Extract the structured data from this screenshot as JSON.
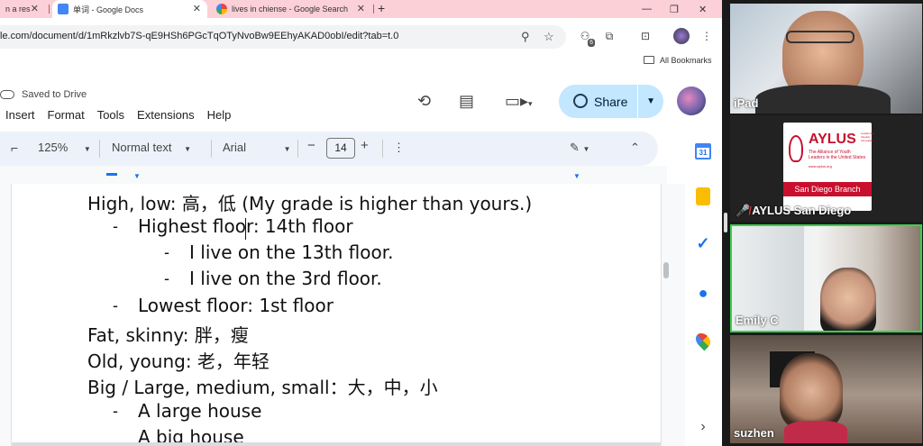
{
  "tabs": [
    {
      "title": "n a res",
      "close": "✕"
    },
    {
      "title": "单词 - Google Docs",
      "close": "✕"
    },
    {
      "title": "lives in chiense - Google Search",
      "close": "✕"
    }
  ],
  "new_tab": "+",
  "window_controls": {
    "minimize": "—",
    "restore": "❐",
    "close": "✕"
  },
  "address": {
    "url": "le.com/document/d/1mRkzlvb7S-qE9HSh6PGcTqOTyNvoBw9EEhyAKAD0obI/edit?tab=t.0"
  },
  "extension_badge": "6",
  "bookmarks": {
    "all_label": "All Bookmarks"
  },
  "docs": {
    "saved_status": "Saved to Drive",
    "menus": [
      "Insert",
      "Format",
      "Tools",
      "Extensions",
      "Help"
    ],
    "share_label": "Share",
    "toolbar": {
      "zoom": "125%",
      "style": "Normal text",
      "font": "Arial",
      "font_size": "14",
      "minus": "−",
      "plus": "+"
    },
    "lines": [
      {
        "text": "High, low: 高，低 (My grade is higher than yours.)",
        "level": 0
      },
      {
        "text": "Highest floor: 14th floor",
        "level": 1
      },
      {
        "text": "I live on the 13th floor.",
        "level": 2
      },
      {
        "text": "I live on the 3rd floor.",
        "level": 2
      },
      {
        "text": "Lowest floor: 1st floor",
        "level": 1
      },
      {
        "text": "Fat, skinny: 胖，瘦",
        "level": 0
      },
      {
        "text": "Old, young: 老，年轻",
        "level": 0
      },
      {
        "text": "Big / Large, medium, small：大，中，小",
        "level": 0
      },
      {
        "text": "A large house",
        "level": 1
      },
      {
        "text": "A big house",
        "level": 1
      }
    ],
    "side_panel": {
      "calendar_day": "31"
    }
  },
  "participants": [
    {
      "name": "iPad"
    },
    {
      "name": "AYLUS San Diego",
      "muted": true,
      "logo": {
        "title": "AYLUS",
        "subtitle": "The Alliance of Youth Leaders in the United States",
        "tagline": "Leadership Integrity Innovation",
        "site": "www.aylus.org",
        "branch": "San Diego Branch"
      }
    },
    {
      "name": "Emily C"
    },
    {
      "name": "suzhen"
    }
  ],
  "colors": {
    "tabstrip": "#fbd0d6",
    "share_button": "#c2e7ff",
    "toolbar": "#edf2fa",
    "active_speaker": "#3ccf4e",
    "aylus_red": "#c8102e"
  }
}
